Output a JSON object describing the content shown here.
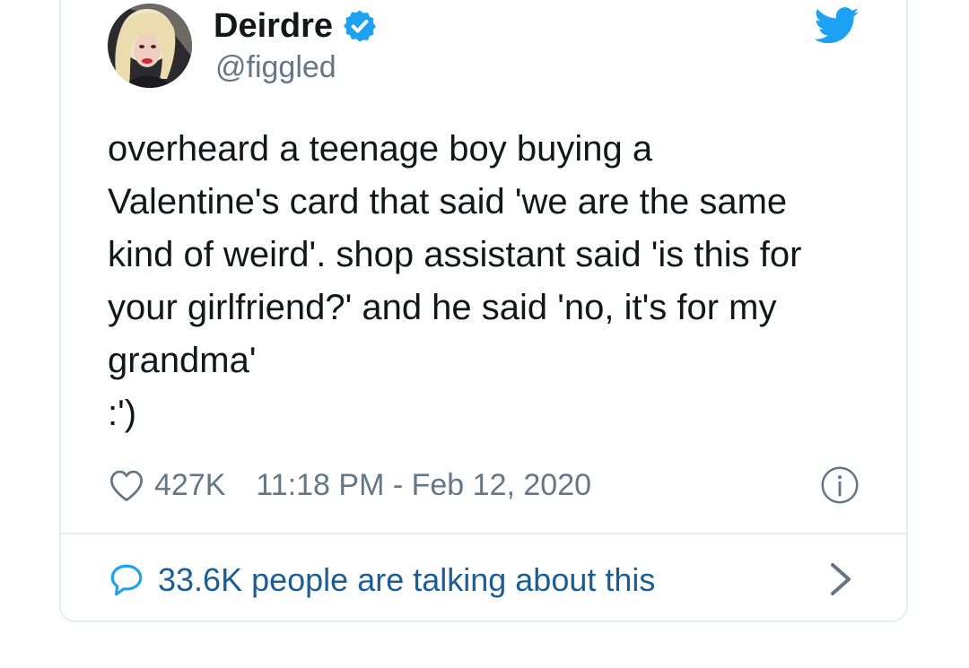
{
  "tweet": {
    "author": {
      "display_name": "Deirdre",
      "handle": "@figgled",
      "verified": true,
      "avatar": "avatar-photo"
    },
    "text": "overheard a teenage boy buying a\nValentine's card that said 'we are the same\nkind of weird'. shop assistant said 'is this for\nyour girlfriend?' and he said 'no, it's for my\ngrandma'\n:')",
    "likes": "427K",
    "timestamp": "11:18 PM - Feb 12, 2020",
    "conversation_label": "33.6K people are talking about this"
  },
  "icons": {
    "brand": "twitter-bird-icon",
    "verified": "verified-badge-icon",
    "like": "heart-icon",
    "info": "info-icon",
    "reply": "speech-bubble-icon",
    "more": "chevron-right-icon"
  },
  "colors": {
    "twitter_blue": "#1da1f2",
    "link_blue": "#1b5e96",
    "secondary_text": "#657786",
    "primary_text": "#14171a",
    "border": "#e6ecf0"
  }
}
